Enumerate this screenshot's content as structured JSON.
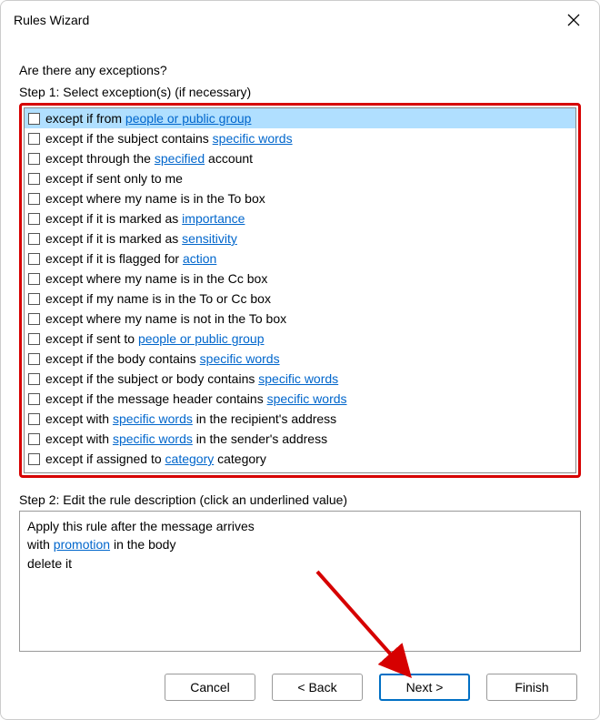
{
  "titlebar": {
    "title": "Rules Wizard"
  },
  "content": {
    "question": "Are there any exceptions?",
    "step1_label": "Step 1: Select exception(s) (if necessary)",
    "step2_label": "Step 2: Edit the rule description (click an underlined value)"
  },
  "exceptions": [
    {
      "selected": true,
      "parts": [
        "except if from ",
        {
          "link": "people or public group"
        }
      ]
    },
    {
      "selected": false,
      "parts": [
        "except if the subject contains ",
        {
          "link": "specific words"
        }
      ]
    },
    {
      "selected": false,
      "parts": [
        "except through the ",
        {
          "link": "specified"
        },
        " account"
      ]
    },
    {
      "selected": false,
      "parts": [
        "except if sent only to me"
      ]
    },
    {
      "selected": false,
      "parts": [
        "except where my name is in the To box"
      ]
    },
    {
      "selected": false,
      "parts": [
        "except if it is marked as ",
        {
          "link": "importance"
        }
      ]
    },
    {
      "selected": false,
      "parts": [
        "except if it is marked as ",
        {
          "link": "sensitivity"
        }
      ]
    },
    {
      "selected": false,
      "parts": [
        "except if it is flagged for ",
        {
          "link": "action"
        }
      ]
    },
    {
      "selected": false,
      "parts": [
        "except where my name is in the Cc box"
      ]
    },
    {
      "selected": false,
      "parts": [
        "except if my name is in the To or Cc box"
      ]
    },
    {
      "selected": false,
      "parts": [
        "except where my name is not in the To box"
      ]
    },
    {
      "selected": false,
      "parts": [
        "except if sent to ",
        {
          "link": "people or public group"
        }
      ]
    },
    {
      "selected": false,
      "parts": [
        "except if the body contains ",
        {
          "link": "specific words"
        }
      ]
    },
    {
      "selected": false,
      "parts": [
        "except if the subject or body contains ",
        {
          "link": "specific words"
        }
      ]
    },
    {
      "selected": false,
      "parts": [
        "except if the message header contains ",
        {
          "link": "specific words"
        }
      ]
    },
    {
      "selected": false,
      "parts": [
        "except with ",
        {
          "link": "specific words"
        },
        " in the recipient's address"
      ]
    },
    {
      "selected": false,
      "parts": [
        "except with ",
        {
          "link": "specific words"
        },
        " in the sender's address"
      ]
    },
    {
      "selected": false,
      "parts": [
        "except if assigned to ",
        {
          "link": "category"
        },
        " category"
      ]
    }
  ],
  "description": {
    "line1_prefix": "Apply this rule after the message arrives",
    "line2_prefix": "with ",
    "line2_link": "promotion",
    "line2_suffix": " in the body",
    "line3": "delete it"
  },
  "buttons": {
    "cancel": "Cancel",
    "back": "< Back",
    "next": "Next >",
    "finish": "Finish"
  },
  "annotation": {
    "highlight_box": "exceptions-list",
    "arrow_target": "next-button",
    "arrow_color": "#d60000"
  }
}
